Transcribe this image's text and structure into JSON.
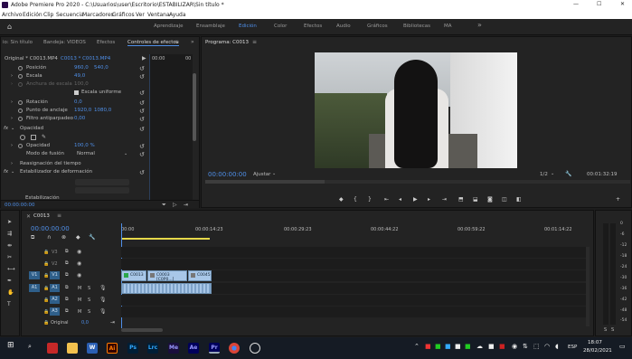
{
  "window": {
    "title": "Adobe Premiere Pro 2020 - C:\\Usuarios\\user\\Escritorio\\ESTABILIZAR\\Sin título *",
    "min": "—",
    "max": "☐",
    "close": "✕"
  },
  "menu": [
    "Archivo",
    "Edición",
    "Clip",
    "Secuencia",
    "Marcadores",
    "Gráficos",
    "Ver",
    "Ventana",
    "Ayuda"
  ],
  "workspaces": [
    "Aprendizaje",
    "Ensamblaje",
    "Edición",
    "Color",
    "Efectos",
    "Audio",
    "Gráficos",
    "Bibliotecas",
    "MA"
  ],
  "workspace_more": "»",
  "effects_panel": {
    "tabs": [
      "io: Sin título",
      "Bandeja: VIDEOS",
      "Efectos",
      "Controles de efectos"
    ],
    "clip_label": "Original * C0013.MP4",
    "seq_label": "C0013 * C0013.MP4",
    "time": "00:00",
    "mini_time": "00",
    "params": [
      {
        "label": "Posición",
        "v1": "960,0",
        "v2": "540,0"
      },
      {
        "label": "Escala",
        "v1": "49,0",
        "v2": ""
      },
      {
        "label": "Anchura de escala",
        "v1": "100,0",
        "v2": ""
      },
      {
        "label": "Escala uniforme",
        "v1": "",
        "v2": ""
      },
      {
        "label": "Rotación",
        "v1": "0,0",
        "v2": ""
      },
      {
        "label": "Punto de anclaje",
        "v1": "1920,0",
        "v2": "1080,0"
      },
      {
        "label": "Filtro antiparpadeo",
        "v1": "0,00",
        "v2": ""
      }
    ],
    "opacity_section": "Opacidad",
    "opacity_label": "Opacidad",
    "opacity_value": "100,0 %",
    "blend_label": "Modo de fusión",
    "blend_value": "Normal",
    "time_remap": "Reasignación del tiempo",
    "stabilizer": "Estabilizador de deformación",
    "stab_row": "Estabilización",
    "bottom_time": "00:00:00:00"
  },
  "program": {
    "title": "Programa: C0013",
    "timecode": "00:00:00:00",
    "fit": "Ajustar",
    "quality": "1/2",
    "duration": "00:01:32:19"
  },
  "timeline": {
    "tab": "C0013",
    "timecode": "00:00:00:00",
    "ruler": [
      "00:00",
      "00:00:14:23",
      "00:00:29:23",
      "00:00:44:22",
      "00:00:59:22",
      "00:01:14:22"
    ],
    "tracks_v": [
      "V3",
      "V2",
      "V1"
    ],
    "tracks_a": [
      "A1",
      "A2",
      "A3"
    ],
    "mix_label": "Original",
    "mix_value": "0,0",
    "clips": [
      "C0013",
      "C0003 [C0P0...]",
      "C0045"
    ]
  },
  "meter": {
    "labels": [
      "0",
      "-6",
      "-12",
      "-18",
      "-24",
      "-30",
      "-36",
      "-42",
      "-48",
      "-54"
    ],
    "s": "S",
    "s2": "S"
  },
  "taskbar": {
    "time": "18:07",
    "date": "28/02/2021",
    "lang": "ESP",
    "apps": [
      {
        "label": "Ai",
        "color": "#ff7c00"
      },
      {
        "label": "Ps",
        "color": "#31a8ff"
      },
      {
        "label": "Lrc",
        "color": "#31a8ff"
      },
      {
        "label": "Me",
        "color": "#9999ff"
      },
      {
        "label": "Ae",
        "color": "#9999ff"
      },
      {
        "label": "Pr",
        "color": "#9999ff"
      }
    ]
  }
}
